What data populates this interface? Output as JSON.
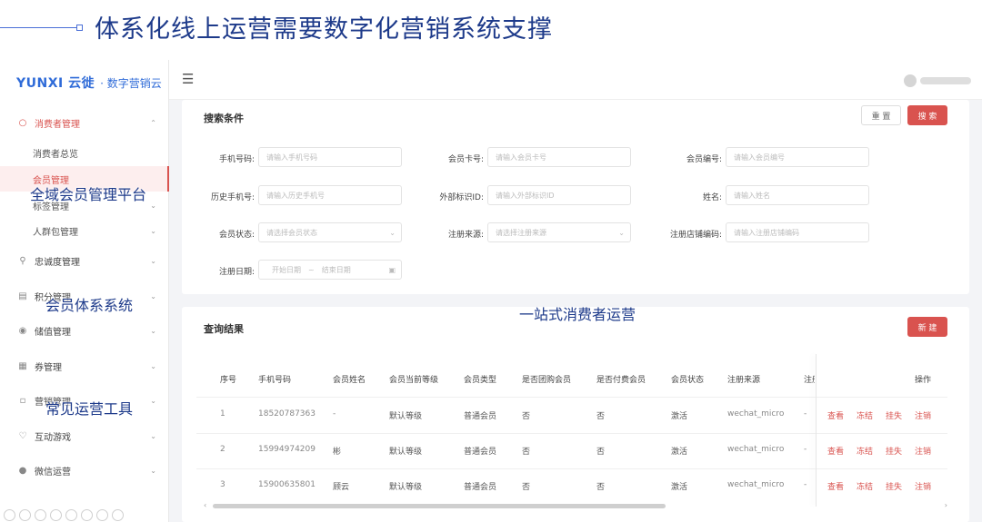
{
  "slide": {
    "title": "体系化线上运营需要数字化营销系统支撑"
  },
  "app": {
    "logo_mark": "YUNXI 云徙",
    "logo_sub": "· 数字营销云",
    "menu_toggle_icon": "menu-fold-icon"
  },
  "sidebar": {
    "groups": [
      {
        "label": "消费者管理",
        "icon": "user-icon",
        "expanded": true
      },
      {
        "label": "忠诚度管理",
        "icon": "location-icon"
      },
      {
        "label": "积分管理",
        "icon": "points-icon"
      },
      {
        "label": "储值管理",
        "icon": "wallet-icon"
      },
      {
        "label": "券管理",
        "icon": "coupon-icon"
      },
      {
        "label": "营销管理",
        "icon": "campaign-icon"
      },
      {
        "label": "互动游戏",
        "icon": "game-icon"
      },
      {
        "label": "微信运营",
        "icon": "wechat-icon"
      }
    ],
    "subs": [
      {
        "label": "消费者总览"
      },
      {
        "label": "会员管理",
        "active": true
      },
      {
        "label": "标签管理"
      },
      {
        "label": "人群包管理"
      }
    ]
  },
  "search": {
    "title": "搜索条件",
    "reset": "重 置",
    "submit": "搜 索",
    "fields": [
      {
        "label": "手机号码:",
        "placeholder": "请输入手机号码"
      },
      {
        "label": "会员卡号:",
        "placeholder": "请输入会员卡号"
      },
      {
        "label": "会员编号:",
        "placeholder": "请输入会员编号"
      },
      {
        "label": "历史手机号:",
        "placeholder": "请输入历史手机号"
      },
      {
        "label": "外部标识ID:",
        "placeholder": "请输入外部标识ID"
      },
      {
        "label": "姓名:",
        "placeholder": "请输入姓名"
      },
      {
        "label": "会员状态:",
        "placeholder": "请选择会员状态"
      },
      {
        "label": "注册来源:",
        "placeholder": "请选择注册来源"
      },
      {
        "label": "注册店铺编码:",
        "placeholder": "请输入注册店铺编码"
      }
    ],
    "date": {
      "label": "注册日期:",
      "start": "开始日期",
      "sep": "~",
      "end": "结束日期"
    }
  },
  "results": {
    "title": "查询结果",
    "new_button": "新 建",
    "columns": [
      "序号",
      "手机号码",
      "会员姓名",
      "会员当前等级",
      "会员类型",
      "是否团购会员",
      "是否付费会员",
      "会员状态",
      "注册来源",
      "注册",
      "操作"
    ],
    "rows": [
      [
        "1",
        "18520787363",
        "-",
        "默认等级",
        "普通会员",
        "否",
        "否",
        "激活",
        "wechat_micro",
        "-"
      ],
      [
        "2",
        "15994974209",
        "彬",
        "默认等级",
        "普通会员",
        "否",
        "否",
        "激活",
        "wechat_micro",
        "-"
      ],
      [
        "3",
        "15900635801",
        "顾云",
        "默认等级",
        "普通会员",
        "否",
        "否",
        "激活",
        "wechat_micro",
        "-"
      ]
    ],
    "actions": [
      "查看",
      "冻结",
      "挂失",
      "注销"
    ]
  },
  "overlays": {
    "a": "全域会员管理平台",
    "b": "会员体系系统",
    "c": "一站式消费者运营",
    "d": "常见运营工具"
  }
}
